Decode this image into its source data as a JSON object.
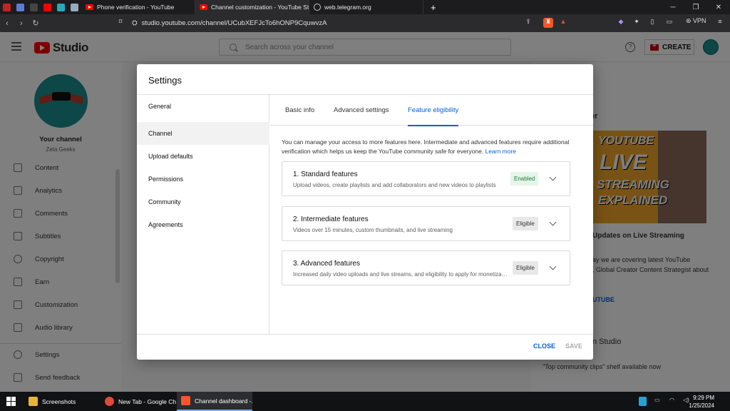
{
  "browser": {
    "tabs": [
      {
        "title": "Phone verification - YouTube"
      },
      {
        "title": "Channel customization - YouTube Stu"
      },
      {
        "title": "web.telegram.org"
      }
    ],
    "url": "studio.youtube.com/channel/UCubXEFJcTo6hONP9CquwvzA",
    "vpn_label": "VPN"
  },
  "studio": {
    "logo_text": "Studio",
    "search_placeholder": "Search across your channel",
    "create_label": "CREATE",
    "sidebar": {
      "channel_label": "Your channel",
      "channel_name": "Zeta Geeks",
      "items": [
        {
          "label": "Content",
          "icon": "content-icon"
        },
        {
          "label": "Analytics",
          "icon": "analytics-icon"
        },
        {
          "label": "Comments",
          "icon": "comments-icon"
        },
        {
          "label": "Subtitles",
          "icon": "subtitles-icon"
        },
        {
          "label": "Copyright",
          "icon": "copyright-icon"
        },
        {
          "label": "Earn",
          "icon": "earn-icon"
        },
        {
          "label": "Customization",
          "icon": "customization-icon"
        },
        {
          "label": "Audio library",
          "icon": "audio-library-icon"
        },
        {
          "label": "Settings",
          "icon": "settings-icon"
        },
        {
          "label": "Send feedback",
          "icon": "feedback-icon"
        }
      ]
    },
    "right_panel": {
      "heading_fragment": "er",
      "thumb_lines": [
        "YOUTUBE",
        "LIVE",
        "STREAMING",
        "EXPLAINED"
      ],
      "video_title_fragment": "Updates on Live Streaming",
      "desc_line1": "ay we are covering latest YouTube",
      "desc_line2": ", Global Creator Content Strategist about",
      "link_fragment": "UTUBE",
      "section2_fragment": "n Studio",
      "section2_item": "\"Top community clips\" shelf available now"
    }
  },
  "dialog": {
    "title": "Settings",
    "nav": [
      "General",
      "Channel",
      "Upload defaults",
      "Permissions",
      "Community",
      "Agreements"
    ],
    "active_nav": "Channel",
    "tabs": [
      "Basic info",
      "Advanced settings",
      "Feature eligibility"
    ],
    "active_tab": "Feature eligibility",
    "intro": "You can manage your access to more features here. Intermediate and advanced features require additional verification which helps us keep the YouTube community safe for everyone.",
    "learn_more": "Learn more",
    "features": [
      {
        "title": "1. Standard features",
        "desc": "Upload videos, create playlists and add collaborators and new videos to playlists",
        "status": "Enabled"
      },
      {
        "title": "2. Intermediate features",
        "desc": "Videos over 15 minutes, custom thumbnails, and live streaming",
        "status": "Eligible"
      },
      {
        "title": "3. Advanced features",
        "desc": "Increased daily video uploads and live streams, and eligibility to apply for monetization",
        "status": "Eligible"
      }
    ],
    "close_label": "CLOSE",
    "save_label": "SAVE"
  },
  "taskbar": {
    "apps": [
      {
        "label": "Screenshots"
      },
      {
        "label": "New Tab - Google Ch..."
      },
      {
        "label": "Channel dashboard -..."
      }
    ],
    "time": "9:29 PM",
    "date": "1/25/2024"
  },
  "colors": {
    "accent": "#065fd4",
    "enabled_bg": "#e6f4ea",
    "enabled_text": "#188038",
    "brand_red": "#ff0000"
  }
}
